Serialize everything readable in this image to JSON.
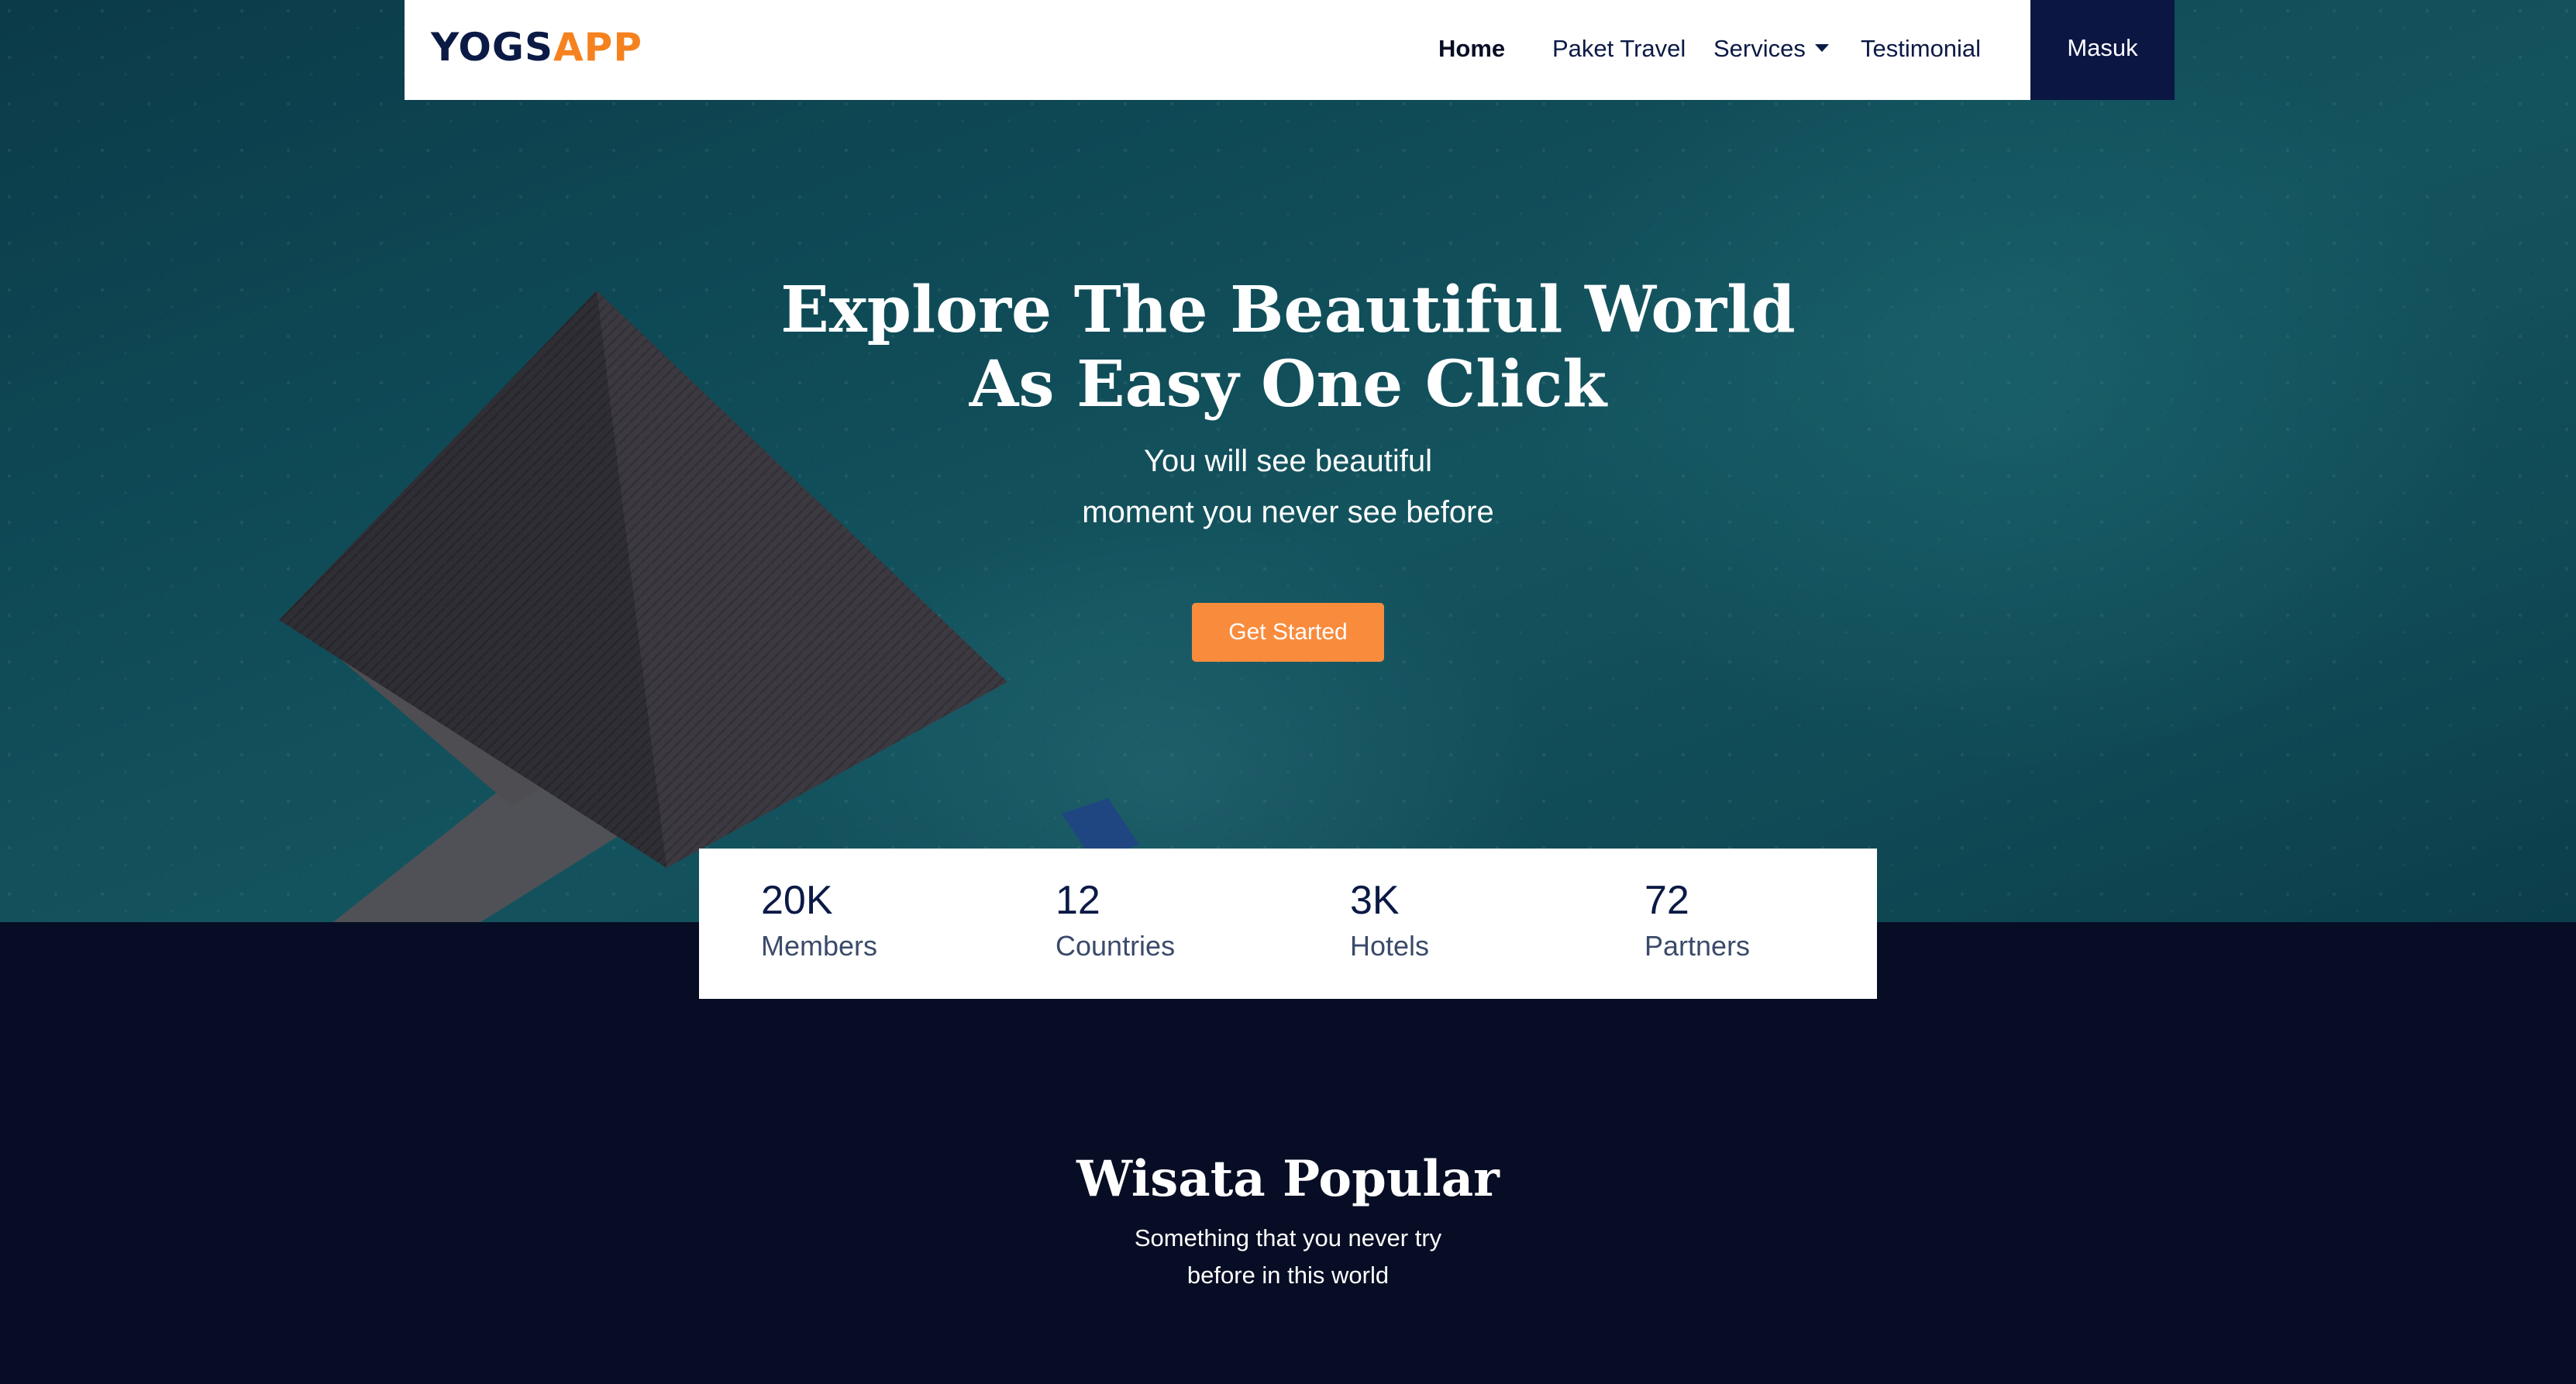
{
  "brand": {
    "part1": "YOGS",
    "part2": "APP"
  },
  "nav": {
    "items": [
      {
        "label": "Home"
      },
      {
        "label": "Paket Travel"
      },
      {
        "label": "Services"
      },
      {
        "label": "Testimonial"
      }
    ],
    "login_label": "Masuk"
  },
  "hero": {
    "title_line1": "Explore The Beautiful World",
    "title_line2": "As Easy One Click",
    "subtitle_line1": "You will see beautiful",
    "subtitle_line2": "moment you never see before",
    "cta_label": "Get Started"
  },
  "stats": [
    {
      "value": "20K",
      "label": "Members"
    },
    {
      "value": "12",
      "label": "Countries"
    },
    {
      "value": "3K",
      "label": "Hotels"
    },
    {
      "value": "72",
      "label": "Partners"
    }
  ],
  "popular": {
    "title": "Wisata Popular",
    "subtitle_line1": "Something that you never try",
    "subtitle_line2": "before in this world"
  },
  "colors": {
    "navy": "#0b1642",
    "dark_bg": "#070d24",
    "accent_orange": "#f98b3c",
    "brand_orange": "#f5821f",
    "sea": "#135f6c"
  }
}
